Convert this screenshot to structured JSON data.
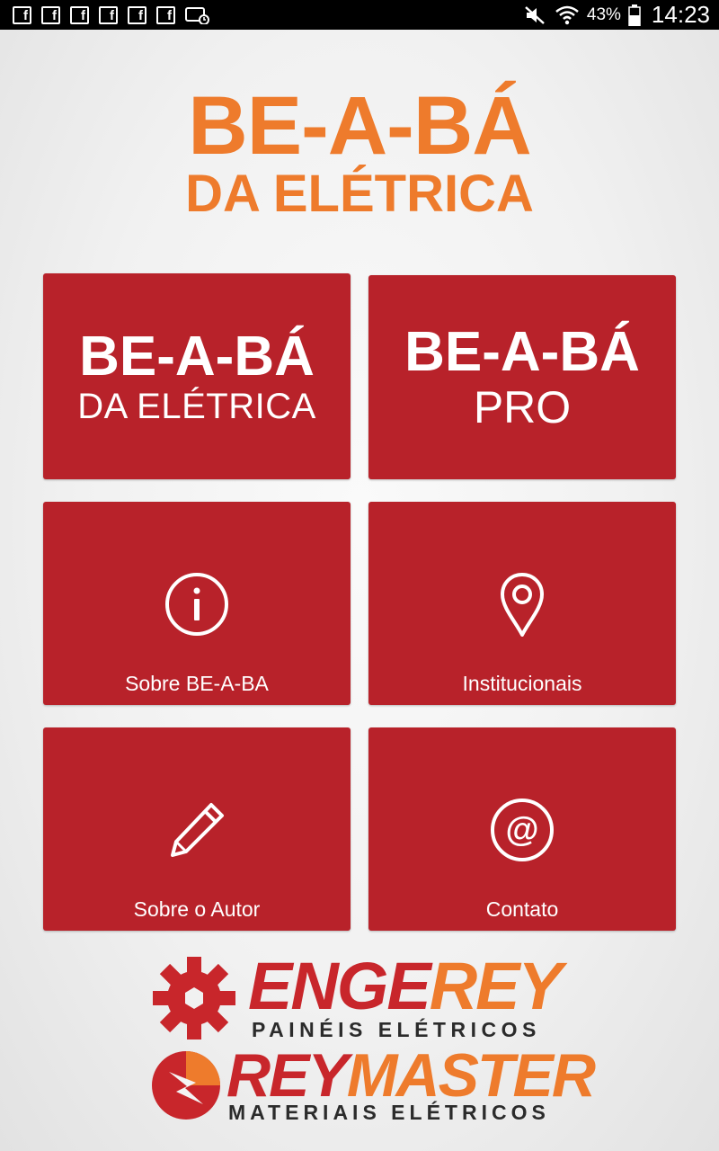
{
  "status_bar": {
    "notification_icons": [
      "facebook-icon",
      "facebook-icon",
      "facebook-icon",
      "facebook-icon",
      "facebook-icon",
      "facebook-icon",
      "screen-timer-icon"
    ],
    "battery_percent": "43%",
    "time": "14:23"
  },
  "header": {
    "title_line1": "BE-A-BÁ",
    "title_line2": "DA ELÉTRICA",
    "color": "#ee7b2c"
  },
  "tiles": {
    "beaba": {
      "line1": "BE-A-BÁ",
      "line2": "DA ELÉTRICA"
    },
    "pro": {
      "line1": "BE-A-BÁ",
      "line2": "PRO"
    },
    "sobre": {
      "label": "Sobre BE-A-BA",
      "icon": "info-icon"
    },
    "institucionais": {
      "label": "Institucionais",
      "icon": "map-pin-icon"
    },
    "autor": {
      "label": "Sobre o Autor",
      "icon": "pencil-icon"
    },
    "contato": {
      "label": "Contato",
      "icon": "at-icon"
    },
    "color": "#b8222a"
  },
  "sponsors": {
    "engerey": {
      "name_a": "ENGE",
      "name_b": "REY",
      "tagline": "PAINÉIS ELÉTRICOS"
    },
    "reymaster": {
      "name_a": "REY",
      "name_b": "MASTER",
      "tagline": "MATERIAIS ELÉTRICOS"
    },
    "colors": {
      "red": "#c8262b",
      "orange": "#ee7b2c"
    }
  }
}
